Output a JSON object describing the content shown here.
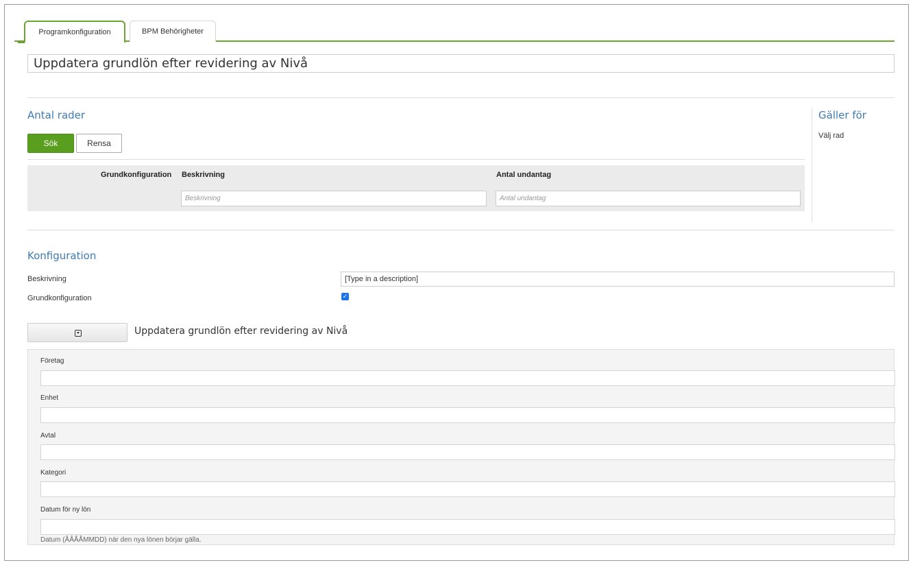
{
  "tabs": [
    {
      "label": "Programkonfiguration",
      "active": true
    },
    {
      "label": "BPM Behörigheter",
      "active": false
    }
  ],
  "title_value": "Uppdatera grundlön efter revidering av Nivå",
  "antal_rader": {
    "heading": "Antal rader",
    "search_label": "Sök",
    "clear_label": "Rensa",
    "columns": [
      "Grundkonfiguration",
      "Beskrivning",
      "Antal undantag"
    ],
    "filters": {
      "beskrivning_placeholder": "Beskrivning",
      "antal_undantag_placeholder": "Antal undantag"
    }
  },
  "galler_for": {
    "heading": "Gäller för",
    "text": "Välj rad"
  },
  "konfiguration": {
    "heading": "Konfiguration",
    "beskrivning_label": "Beskrivning",
    "beskrivning_value": "[Type in a description]",
    "grundkonfiguration_label": "Grundkonfiguration",
    "grundkonfiguration_checked": true
  },
  "collapse": {
    "icon": "chevron-down-box-icon",
    "title": "Uppdatera grundlön efter revidering av Nivå"
  },
  "fields": [
    {
      "label": "Företag",
      "value": ""
    },
    {
      "label": "Enhet",
      "value": ""
    },
    {
      "label": "Avtal",
      "value": ""
    },
    {
      "label": "Kategori",
      "value": ""
    },
    {
      "label": "Datum för ny lön",
      "value": ""
    }
  ],
  "date_help": "Datum (ÅÅÅÅMMDD) när den nya lönen börjar gälla.",
  "colors": {
    "accent_green": "#5a9e1f",
    "heading_blue": "#3e7bb5"
  }
}
